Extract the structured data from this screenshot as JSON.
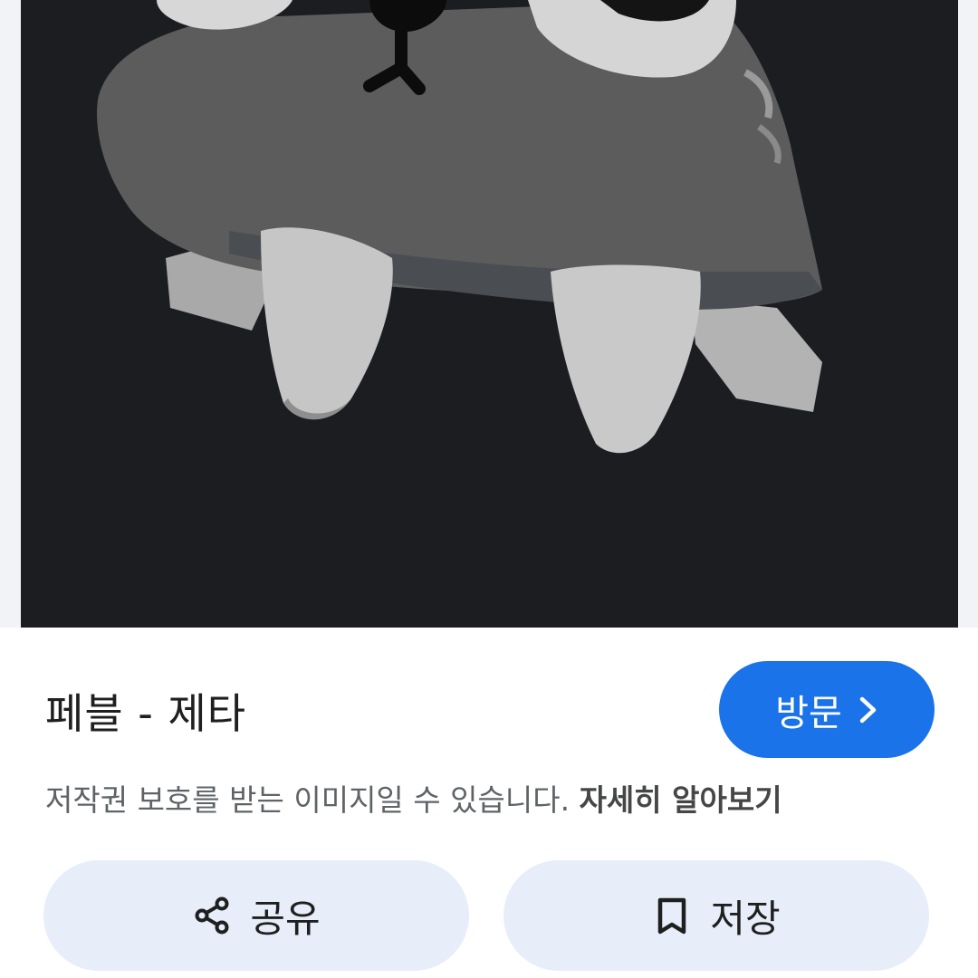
{
  "image": {
    "subject": "stylized grey creature figure with pointed legs on dark background"
  },
  "result": {
    "title": "페블 - 제타",
    "visit_label": "방문",
    "copyright_notice": "저작권 보호를 받는 이미지일 수 있습니다. ",
    "learn_more_label": "자세히 알아보기"
  },
  "actions": {
    "share_label": "공유",
    "save_label": "저장"
  },
  "icons": {
    "visit": "chevron-right-icon",
    "share": "share-icon",
    "save": "bookmark-icon"
  },
  "colors": {
    "accent": "#1a73e8",
    "action_bg": "#e7eef9",
    "image_bg": "#1c1d20"
  }
}
